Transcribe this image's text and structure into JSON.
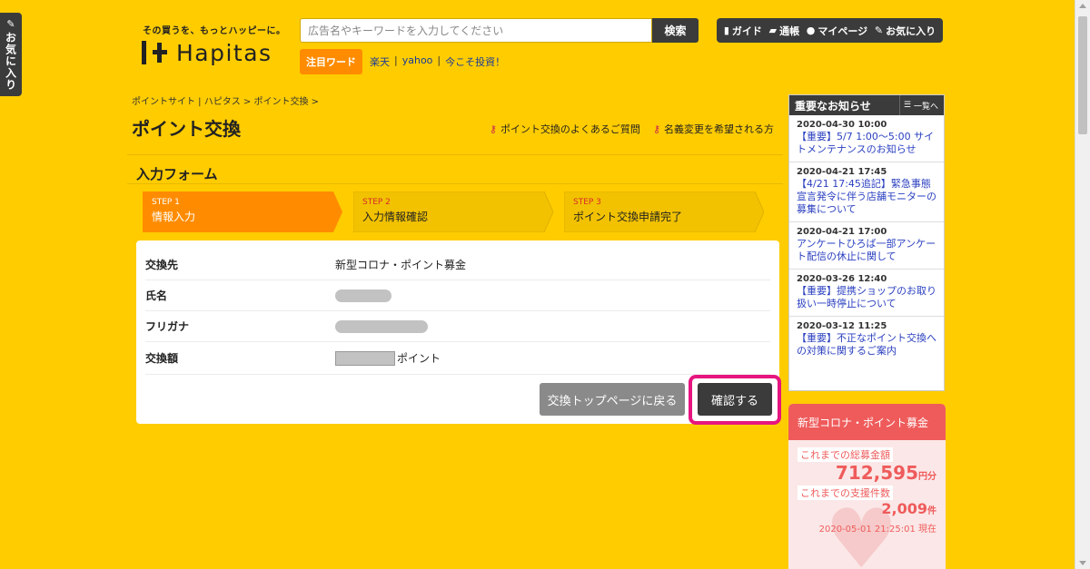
{
  "fav_tab": {
    "label": "お気に入り"
  },
  "header": {
    "tagline": "その買うを、もっとハッピーに。",
    "logo_text": "Hapitas",
    "search_placeholder": "広告名やキーワードを入力してください",
    "search_button": "検索",
    "keyword_badge": "注目ワード",
    "keywords": [
      "楽天",
      "yahoo",
      "今こそ投資！"
    ],
    "nav": [
      {
        "icon": "book-icon",
        "label": "ガイド"
      },
      {
        "icon": "passbook-icon",
        "label": "通帳"
      },
      {
        "icon": "person-icon",
        "label": "マイページ"
      },
      {
        "icon": "clip-icon",
        "label": "お気に入り"
      }
    ]
  },
  "breadcrumb": "ポイントサイト | ハピタス > ポイント交換 >",
  "page_title": "ポイント交換",
  "help_links": [
    "ポイント交換のよくあるご質問",
    "名義変更を希望される方"
  ],
  "form": {
    "title": "入力フォーム",
    "steps": [
      {
        "num": "STEP 1",
        "label": "情報入力",
        "active": true
      },
      {
        "num": "STEP 2",
        "label": "入力情報確認",
        "active": false
      },
      {
        "num": "STEP 3",
        "label": "ポイント交換申請完了",
        "active": false
      }
    ],
    "rows": [
      {
        "label": "交換先",
        "value": "新型コロナ・ポイント募金"
      },
      {
        "label": "氏名",
        "value": ""
      },
      {
        "label": "フリガナ",
        "value": ""
      },
      {
        "label": "交換額",
        "value": "ポイント"
      }
    ],
    "back_button": "交換トップページに戻る",
    "confirm_button": "確認する"
  },
  "notices": {
    "title": "重要なお知らせ",
    "all_label": "一覧へ",
    "items": [
      {
        "date": "2020-04-30 10:00",
        "text": "【重要】5/7 1:00～5:00 サイトメンテナンスのお知らせ"
      },
      {
        "date": "2020-04-21 17:45",
        "text": "【4/21 17:45追記】緊急事態宣言発令に伴う店舗モニターの募集について"
      },
      {
        "date": "2020-04-21 17:00",
        "text": "アンケートひろば一部アンケート配信の休止に関して"
      },
      {
        "date": "2020-03-26 12:40",
        "text": "【重要】提携ショップのお取り扱い一時停止について"
      },
      {
        "date": "2020-03-12 11:25",
        "text": "【重要】不正なポイント交換への対策に関するご案内"
      }
    ]
  },
  "donation": {
    "title": "新型コロナ・ポイント募金",
    "total_label": "これまでの総募金額",
    "total_value": "712,595",
    "total_unit": "円分",
    "count_label": "これまでの支援件数",
    "count_value": "2,009",
    "count_unit": "件",
    "timestamp": "2020-05-01 21:25:01 現在"
  },
  "colors": {
    "accent": "#ffcc00",
    "dark": "#3b3b3b",
    "step_active": "#ff8c00",
    "highlight": "#e6157f",
    "donation": "#ef5b5b"
  }
}
